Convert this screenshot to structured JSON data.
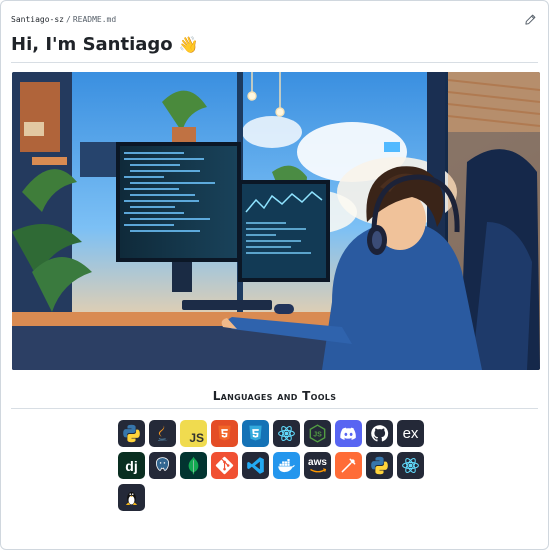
{
  "breadcrumb": {
    "owner": "Santiago-sz",
    "separator": "/",
    "file": "README.md"
  },
  "header": {
    "title": "Hi, I'm Santiago",
    "emoji": "👋"
  },
  "hero": {
    "alt": "Anime-style illustration of a developer with headphones coding at a multi-monitor desk setup"
  },
  "tools": {
    "heading": "Languages and Tools",
    "icons": [
      {
        "name": "python-icon",
        "bg": "#242938"
      },
      {
        "name": "java-icon",
        "bg": "#242938"
      },
      {
        "name": "javascript-icon",
        "label": "JS",
        "bg": "#f0db4f"
      },
      {
        "name": "html5-icon",
        "bg": "#e44d26"
      },
      {
        "name": "css3-icon",
        "bg": "#1572b6"
      },
      {
        "name": "react-icon",
        "bg": "#242938"
      },
      {
        "name": "nodejs-icon",
        "bg": "#242938"
      },
      {
        "name": "discord-icon",
        "bg": "#5865f2"
      },
      {
        "name": "github-icon",
        "bg": "#242938"
      },
      {
        "name": "express-icon",
        "label": "ex",
        "bg": "#242938"
      },
      {
        "name": "django-icon",
        "label": "dj",
        "bg": "#092e20"
      },
      {
        "name": "postgresql-icon",
        "bg": "#242938"
      },
      {
        "name": "mongodb-icon",
        "bg": "#023430"
      },
      {
        "name": "git-icon",
        "bg": "#f05032"
      },
      {
        "name": "vscode-icon",
        "bg": "#242938"
      },
      {
        "name": "docker-icon",
        "bg": "#2496ed"
      },
      {
        "name": "aws-icon",
        "label": "aws",
        "bg": "#242938"
      },
      {
        "name": "postman-icon",
        "bg": "#ff6c37"
      },
      {
        "name": "python-icon",
        "bg": "#242938"
      },
      {
        "name": "react-icon",
        "bg": "#242938"
      },
      {
        "name": "linux-icon",
        "bg": "#242938"
      }
    ]
  }
}
